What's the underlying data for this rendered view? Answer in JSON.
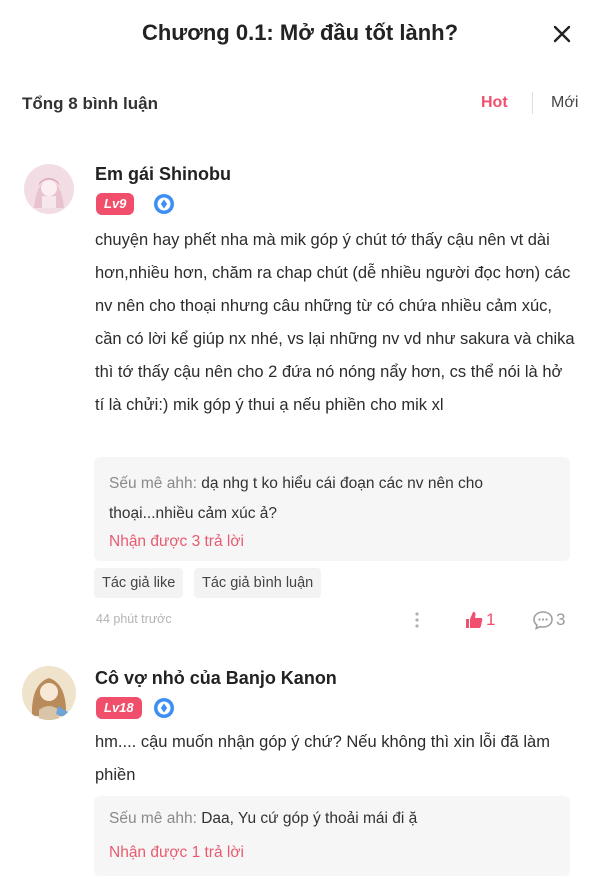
{
  "header": {
    "title": "Chương 0.1: Mở đầu tốt lành?"
  },
  "subbar": {
    "total": "Tổng 8 bình luận",
    "sort_hot": "Hot",
    "sort_new": "Mới"
  },
  "comments": [
    {
      "username": "Em gái Shinobu",
      "level": "Lv9",
      "text": "chuyện hay phết nha mà mik góp ý chút tớ thấy cậu nên vt dài hơn,nhiều hơn, chăm ra chap chút (dễ nhiều người đọc hơn) các nv nên cho thoại nhưng câu những từ có chứa nhiều cảm xúc, cần có lời kể giúp nx nhé, vs lại những nv vd như sakura và chika thì tớ thấy cậu nên cho 2 đứa nó nóng nẩy hơn, cs thể nói là hở tí là chửi:) mik góp ý thui ạ nếu phiền cho mik xl",
      "reply": {
        "author": "Sếu mê ahh:",
        "text": "dạ nhg t ko hiểu cái đoạn các nv nên cho thoại...nhiều cảm xúc ả?",
        "link": "Nhận được 3 trả lời"
      },
      "tags": [
        "Tác giả like",
        "Tác giả bình luận"
      ],
      "time": "44 phút trước",
      "likes": "1",
      "replies": "3"
    },
    {
      "username": "Cô vợ nhỏ của Banjo Kanon",
      "level": "Lv18",
      "text": "hm.... cậu muốn nhận góp ý chứ? Nếu không thì xin lỗi đã làm phiền",
      "reply": {
        "author": "Sếu mê ahh:",
        "text": "Daa, Yu cứ góp ý thoải mái đi ặ",
        "link": "Nhận được 1 trả lời"
      }
    }
  ],
  "colors": {
    "accent": "#f0506e",
    "level_badge": "#f04e6a",
    "verified_badge": "#3d8ef2",
    "reply_link": "#e85b6f",
    "reply_bg": "#f6f6f6"
  },
  "icons": {
    "close": "close-icon",
    "more": "more-vertical-icon",
    "like": "thumbs-up-icon",
    "reply": "speech-bubble-icon",
    "verified": "verified-badge-icon"
  }
}
